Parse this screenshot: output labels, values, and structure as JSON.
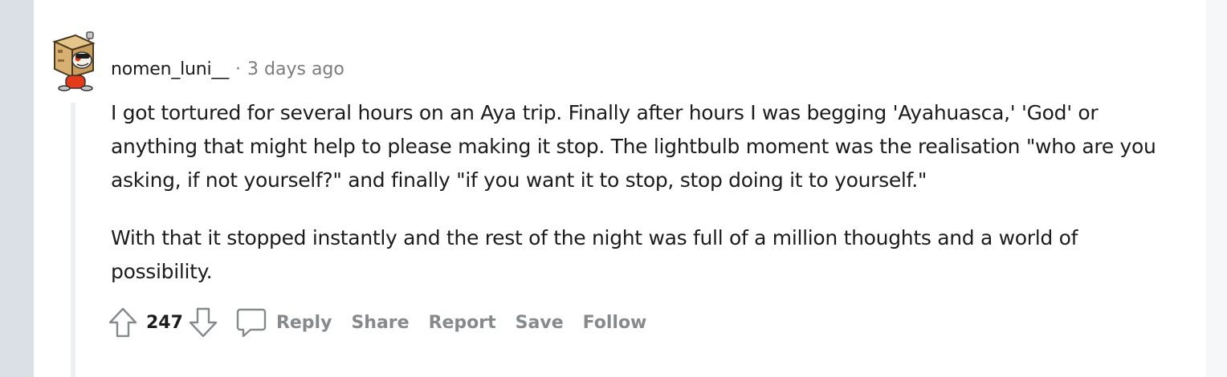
{
  "comment": {
    "username": "nomen_luni__",
    "separator": "·",
    "timestamp": "3 days ago",
    "paragraphs": [
      "I got tortured for several hours on an Aya trip. Finally after hours I was begging 'Ayahuasca,' 'God' or anything that might help to please making it stop. The lightbulb moment was the realisation \"who are you asking, if not yourself?\" and finally \"if you want it to stop, stop doing it to yourself.\"",
      "With that it stopped instantly and the rest of the night was full of a million thoughts and a world of possibility."
    ],
    "score": "247"
  },
  "actions": {
    "reply": "Reply",
    "share": "Share",
    "report": "Report",
    "save": "Save",
    "follow": "Follow"
  },
  "icons": {
    "upvote": "arrow-up-icon",
    "downvote": "arrow-down-icon",
    "reply": "comment-bubble-icon",
    "avatar": "snoo-avatar"
  },
  "colors": {
    "page_bg": "#dae0e6",
    "card_bg": "#ffffff",
    "text": "#1c1c1c",
    "muted": "#7c7c7c",
    "action": "#878a8c",
    "thread_line": "#edeff1"
  }
}
